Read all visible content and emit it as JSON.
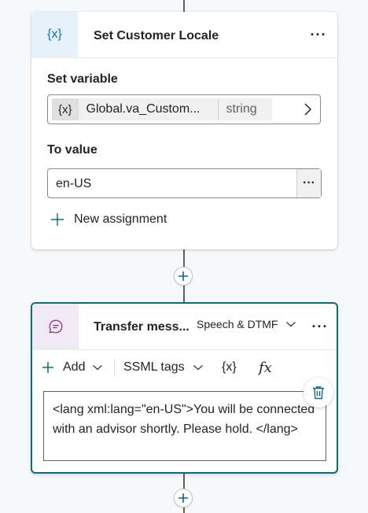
{
  "node1": {
    "title": "Set Customer Locale",
    "icon": "variable-icon",
    "icon_glyph": "{x}",
    "more_label": "···",
    "set_variable_label": "Set variable",
    "variable": {
      "icon_glyph": "{x}",
      "name": "Global.va_Custom...",
      "type": "string"
    },
    "to_value_label": "To value",
    "to_value": "en-US",
    "to_value_more": "···",
    "new_assignment_label": "New assignment"
  },
  "node2": {
    "title": "Transfer mess...",
    "icon": "message-icon",
    "mode_selected": "Speech & DTMF",
    "more_label": "···",
    "toolbar": {
      "add_label": "Add",
      "ssml_label": "SSML tags",
      "variable_glyph": "{x}",
      "formula_glyph": "fx"
    },
    "message_text": "<lang xml:lang=\"en-US\">You will be connected with an advisor shortly. Please hold. </lang>"
  },
  "colors": {
    "accent": "#0f6b78",
    "variable_icon": "#0f6cbd",
    "message_icon": "#8a3f8c",
    "connector": "#616161"
  }
}
